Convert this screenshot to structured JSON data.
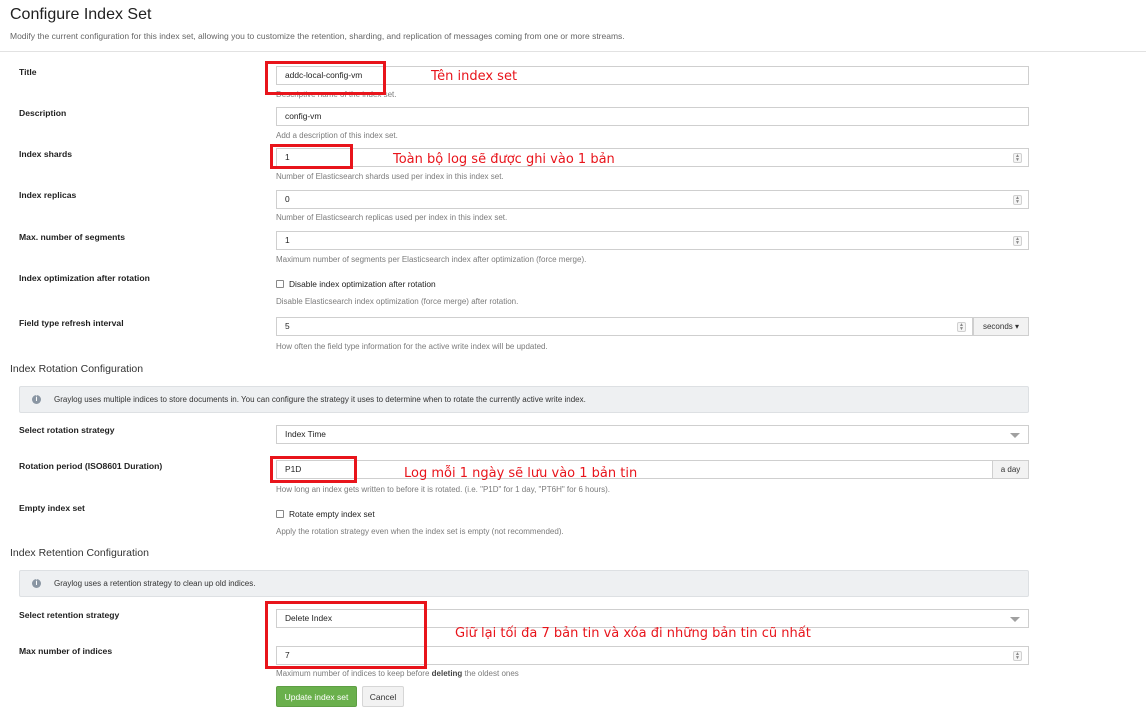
{
  "header": {
    "title": "Configure Index Set",
    "subtitle": "Modify the current configuration for this index set, allowing you to customize the retention, sharding, and replication of messages coming from one or more streams."
  },
  "fields": {
    "title": {
      "label": "Title",
      "value": "addc-local-config-vm",
      "help": "Descriptive name of the index set."
    },
    "description": {
      "label": "Description",
      "value": "config-vm",
      "help": "Add a description of this index set."
    },
    "shards": {
      "label": "Index shards",
      "value": "1",
      "help": "Number of Elasticsearch shards used per index in this index set."
    },
    "replicas": {
      "label": "Index replicas",
      "value": "0",
      "help": "Number of Elasticsearch replicas used per index in this index set."
    },
    "segments": {
      "label": "Max. number of segments",
      "value": "1",
      "help": "Maximum number of segments per Elasticsearch index after optimization (force merge)."
    },
    "optimization": {
      "label": "Index optimization after rotation",
      "checkbox": "Disable index optimization after rotation",
      "help": "Disable Elasticsearch index optimization (force merge) after rotation."
    },
    "refresh": {
      "label": "Field type refresh interval",
      "value": "5",
      "unit": "seconds",
      "caret": "▾",
      "help": "How often the field type information for the active write index will be updated."
    }
  },
  "rotation": {
    "section_title": "Index Rotation Configuration",
    "info": "Graylog uses multiple indices to store documents in. You can configure the strategy it uses to determine when to rotate the currently active write index.",
    "strategy_label": "Select rotation strategy",
    "strategy_value": "Index Time",
    "period_label": "Rotation period (ISO8601 Duration)",
    "period_value": "P1D",
    "period_addon": "a day",
    "period_help": "How long an index gets written to before it is rotated. (i.e. \"P1D\" for 1 day, \"PT6H\" for 6 hours).",
    "empty_label": "Empty index set",
    "empty_checkbox": "Rotate empty index set",
    "empty_help": "Apply the rotation strategy even when the index set is empty (not recommended)."
  },
  "retention": {
    "section_title": "Index Retention Configuration",
    "info": "Graylog uses a retention strategy to clean up old indices.",
    "strategy_label": "Select retention strategy",
    "strategy_value": "Delete Index",
    "max_label": "Max number of indices",
    "max_value": "7",
    "max_help_pre": "Maximum number of indices to keep before ",
    "max_help_bold": "deleting",
    "max_help_post": " the oldest ones"
  },
  "actions": {
    "update": "Update index set",
    "cancel": "Cancel"
  },
  "annotations": {
    "title_note": "Tên index set",
    "shards_note": "Toàn bộ log sẽ được ghi vào 1 bản",
    "rotation_note": "Log mỗi 1 ngày sẽ lưu vào 1 bản tin",
    "retention_note": "Giữ lại tối đa 7 bản tin và xóa đi những bản tin cũ nhất"
  },
  "colors": {
    "annotation": "#e8141b",
    "primary_button": "#6ab04c",
    "info_bg": "#eef0f2"
  }
}
